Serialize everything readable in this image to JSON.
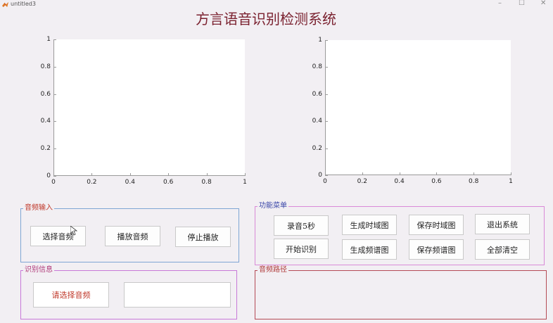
{
  "window": {
    "title": "untitled3",
    "controls": {
      "minimize": "–",
      "maximize": "☐",
      "close": "✕"
    }
  },
  "app": {
    "title": "方言语音识别检测系统"
  },
  "axes_left": {
    "yticks": [
      "0",
      "0.2",
      "0.4",
      "0.6",
      "0.8",
      "1"
    ],
    "xticks": [
      "0",
      "0.2",
      "0.4",
      "0.6",
      "0.8",
      "1"
    ]
  },
  "axes_right": {
    "yticks": [
      "0",
      "0.2",
      "0.4",
      "0.6",
      "0.8",
      "1"
    ],
    "xticks": [
      "0",
      "0.2",
      "0.4",
      "0.6",
      "0.8",
      "1"
    ]
  },
  "audio_input": {
    "label": "音频输入",
    "select_audio": "选择音频",
    "play_audio": "播放音频",
    "stop_play": "停止播放"
  },
  "recognition_info": {
    "label": "识别信息",
    "status_text": "请选择音频",
    "result_text": ""
  },
  "function_menu": {
    "label": "功能菜单",
    "record_5s": "录音5秒",
    "start_recognition": "开始识别",
    "gen_time_plot": "生成时域图",
    "gen_spectrum_plot": "生成频谱图",
    "save_time_plot": "保存时域图",
    "save_spectrum_plot": "保存频谱图",
    "exit_system": "退出系统",
    "clear_all": "全部清空"
  },
  "audio_path": {
    "label": "音频路径",
    "value": ""
  },
  "colors": {
    "background": "#f2eff3",
    "title": "#7b2230",
    "audio_input_border": "#7fa6d4",
    "audio_input_label": "#c0392b",
    "recognition_border": "#c879d8",
    "recognition_label": "#b03a7a",
    "menu_border": "#d98ad8",
    "menu_label": "#3a46a8",
    "path_border": "#b54a55",
    "path_label": "#b03a3a",
    "status_text": "#c0392b"
  }
}
